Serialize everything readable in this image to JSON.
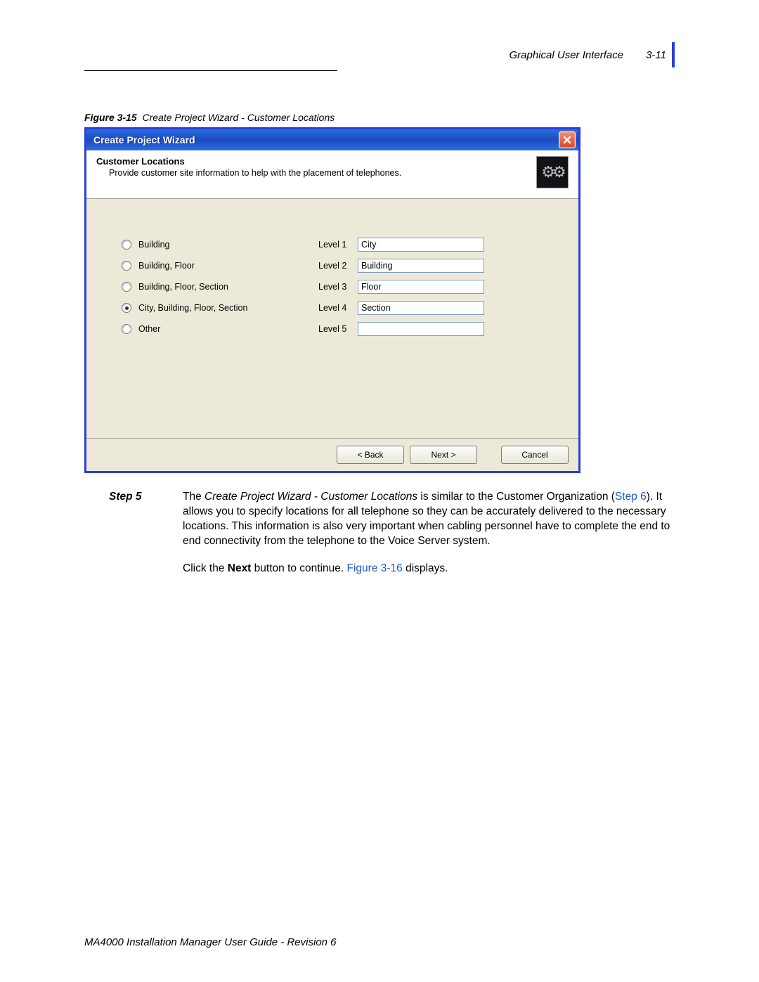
{
  "header": {
    "section": "Graphical User Interface",
    "page": "3-11"
  },
  "caption": {
    "prefix": "Figure 3-15",
    "text": "Create Project Wizard - Customer Locations"
  },
  "window": {
    "title": "Create Project Wizard",
    "heading": "Customer Locations",
    "subheading": "Provide customer site information to help with the placement of telephones.",
    "radios": [
      {
        "label": "Building",
        "checked": false
      },
      {
        "label": "Building, Floor",
        "checked": false
      },
      {
        "label": "Building, Floor, Section",
        "checked": false
      },
      {
        "label": "City, Building, Floor, Section",
        "checked": true
      },
      {
        "label": "Other",
        "checked": false
      }
    ],
    "levels": [
      {
        "label": "Level 1",
        "value": "City"
      },
      {
        "label": "Level 2",
        "value": "Building"
      },
      {
        "label": "Level 3",
        "value": "Floor"
      },
      {
        "label": "Level 4",
        "value": "Section"
      },
      {
        "label": "Level 5",
        "value": ""
      }
    ],
    "buttons": {
      "back": "< Back",
      "next": "Next >",
      "cancel": "Cancel"
    }
  },
  "step": {
    "label": "Step 5",
    "p1_a": "The ",
    "p1_b": "Create Project Wizard - Customer Locations",
    "p1_c": " is similar to the Customer Organization (",
    "p1_link1": "Step 6",
    "p1_d": "). It allows you to specify locations for all telephone so they can be accurately delivered to the necessary locations. This information is also very important when cabling personnel have to complete the end to end connectivity from the telephone to the Voice Server system.",
    "p2_a": "Click the ",
    "p2_b": "Next",
    "p2_c": " button to continue. ",
    "p2_link": "Figure 3-16",
    "p2_d": " displays."
  },
  "footer": "MA4000 Installation Manager User Guide - Revision 6"
}
